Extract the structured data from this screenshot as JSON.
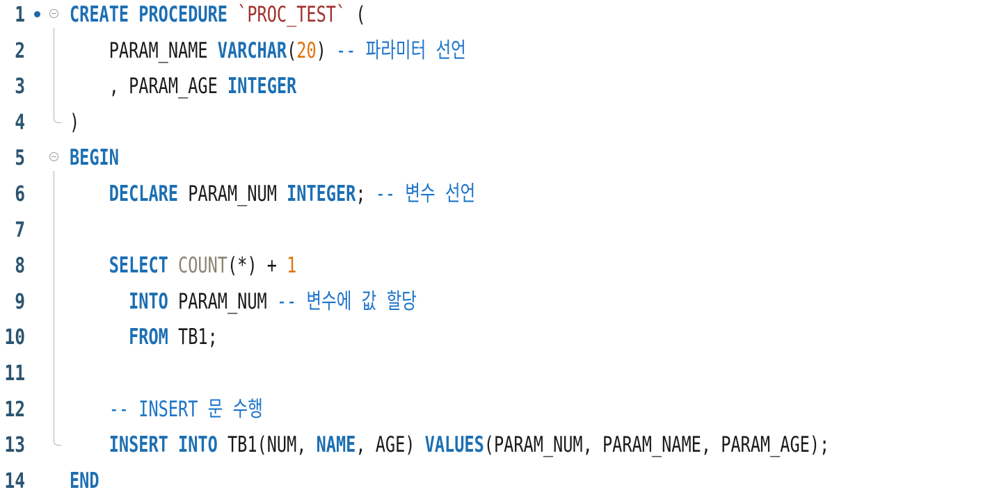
{
  "editor": {
    "line_numbers": [
      "1",
      "2",
      "3",
      "4",
      "5",
      "6",
      "7",
      "8",
      "9",
      "10",
      "11",
      "12",
      "13",
      "14"
    ],
    "lines": [
      [
        {
          "t": "kw",
          "v": "CREATE PROCEDURE"
        },
        {
          "t": "plain",
          "v": " "
        },
        {
          "t": "str",
          "v": "`PROC_TEST`"
        },
        {
          "t": "plain",
          "v": " ("
        }
      ],
      [
        {
          "t": "plain",
          "v": "    PARAM_NAME "
        },
        {
          "t": "kw",
          "v": "VARCHAR"
        },
        {
          "t": "plain",
          "v": "("
        },
        {
          "t": "num",
          "v": "20"
        },
        {
          "t": "plain",
          "v": ") "
        },
        {
          "t": "cm",
          "v": "-- 파라미터 선언"
        }
      ],
      [
        {
          "t": "plain",
          "v": "    , PARAM_AGE "
        },
        {
          "t": "kw",
          "v": "INTEGER"
        }
      ],
      [
        {
          "t": "plain",
          "v": ")"
        }
      ],
      [
        {
          "t": "kw",
          "v": "BEGIN"
        }
      ],
      [
        {
          "t": "plain",
          "v": "    "
        },
        {
          "t": "kw",
          "v": "DECLARE"
        },
        {
          "t": "plain",
          "v": " PARAM_NUM "
        },
        {
          "t": "kw",
          "v": "INTEGER"
        },
        {
          "t": "plain",
          "v": "; "
        },
        {
          "t": "cm",
          "v": "-- 변수 선언"
        }
      ],
      [],
      [
        {
          "t": "plain",
          "v": "    "
        },
        {
          "t": "kw",
          "v": "SELECT"
        },
        {
          "t": "plain",
          "v": " "
        },
        {
          "t": "fn",
          "v": "COUNT"
        },
        {
          "t": "plain",
          "v": "(*) + "
        },
        {
          "t": "num",
          "v": "1"
        }
      ],
      [
        {
          "t": "plain",
          "v": "      "
        },
        {
          "t": "kw",
          "v": "INTO"
        },
        {
          "t": "plain",
          "v": " PARAM_NUM "
        },
        {
          "t": "cm",
          "v": "-- 변수에 값 할당"
        }
      ],
      [
        {
          "t": "plain",
          "v": "      "
        },
        {
          "t": "kw",
          "v": "FROM"
        },
        {
          "t": "plain",
          "v": " TB1;"
        }
      ],
      [],
      [
        {
          "t": "plain",
          "v": "    "
        },
        {
          "t": "cm",
          "v": "-- INSERT 문 수행"
        }
      ],
      [
        {
          "t": "plain",
          "v": "    "
        },
        {
          "t": "kw",
          "v": "INSERT INTO"
        },
        {
          "t": "plain",
          "v": " TB1(NUM, "
        },
        {
          "t": "kw",
          "v": "NAME"
        },
        {
          "t": "plain",
          "v": ", AGE) "
        },
        {
          "t": "kw",
          "v": "VALUES"
        },
        {
          "t": "plain",
          "v": "(PARAM_NUM, PARAM_NAME, PARAM_AGE);"
        }
      ],
      [
        {
          "t": "kw",
          "v": "END"
        }
      ]
    ]
  },
  "colors": {
    "keyword": "#1d6fb3",
    "comment": "#1d74c9",
    "number": "#e0740a",
    "string": "#a0302c",
    "function": "#8a8470",
    "plain": "#1a1a1a",
    "line_number": "#2b5570"
  },
  "gutter": {
    "breakpoint_marker_line": 1,
    "fold_toggle_lines": [
      1,
      5
    ],
    "fold_icon_name": "fold-collapse-icon",
    "breakpoint_icon_name": "breakpoint-dot-icon"
  }
}
